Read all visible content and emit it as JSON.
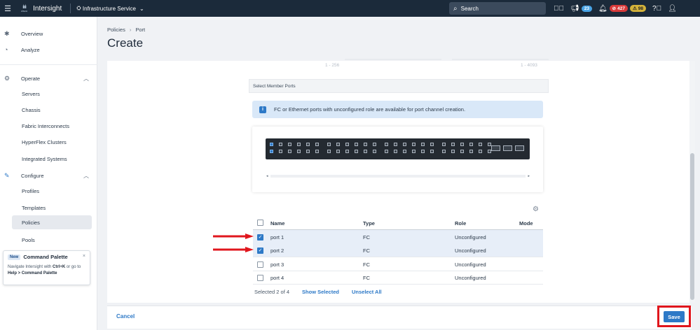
{
  "topbar": {
    "brand": "Intersight",
    "cisco_logo_text": "cisco",
    "service": "Infrastructure Service",
    "search_label": "Search",
    "announcements_count": "23",
    "critical_count": "427",
    "warning_count": "98"
  },
  "sidebar": {
    "overview": "Overview",
    "analyze": "Analyze",
    "operate": "Operate",
    "operate_items": [
      "Servers",
      "Chassis",
      "Fabric Interconnects",
      "HyperFlex Clusters",
      "Integrated Systems"
    ],
    "configure": "Configure",
    "configure_items": [
      "Profiles",
      "Templates",
      "Policies",
      "Pools"
    ]
  },
  "command_palette": {
    "badge": "New",
    "title": "Command Palette",
    "desc_pre": "Navigate Intersight with ",
    "shortcut": "Ctrl+K",
    "desc_mid": " or go to ",
    "path": "Help > Command Palette"
  },
  "header": {
    "crumb_1": "Policies",
    "crumb_2": "Port",
    "title": "Create"
  },
  "form": {
    "range_left": "1 - 256",
    "range_right": "1 - 4093",
    "section_label": "Select Member Ports",
    "info_text": "FC or Ethernet ports with unconfigured role are available for port channel creation."
  },
  "table": {
    "columns": [
      "Name",
      "Type",
      "Role",
      "Mode"
    ],
    "rows": [
      {
        "name": "port 1",
        "type": "FC",
        "role": "Unconfigured",
        "mode": "",
        "checked": true
      },
      {
        "name": "port 2",
        "type": "FC",
        "role": "Unconfigured",
        "mode": "",
        "checked": true
      },
      {
        "name": "port 3",
        "type": "FC",
        "role": "Unconfigured",
        "mode": "",
        "checked": false
      },
      {
        "name": "port 4",
        "type": "FC",
        "role": "Unconfigured",
        "mode": "",
        "checked": false
      }
    ],
    "selected_summary": "Selected 2 of 4",
    "show_selected": "Show Selected",
    "unselect_all": "Unselect All"
  },
  "footer": {
    "cancel": "Cancel",
    "save": "Save"
  },
  "colors": {
    "topbar": "#1b2a3a",
    "accent": "#2d79c7",
    "highlight": "#e0161d"
  }
}
